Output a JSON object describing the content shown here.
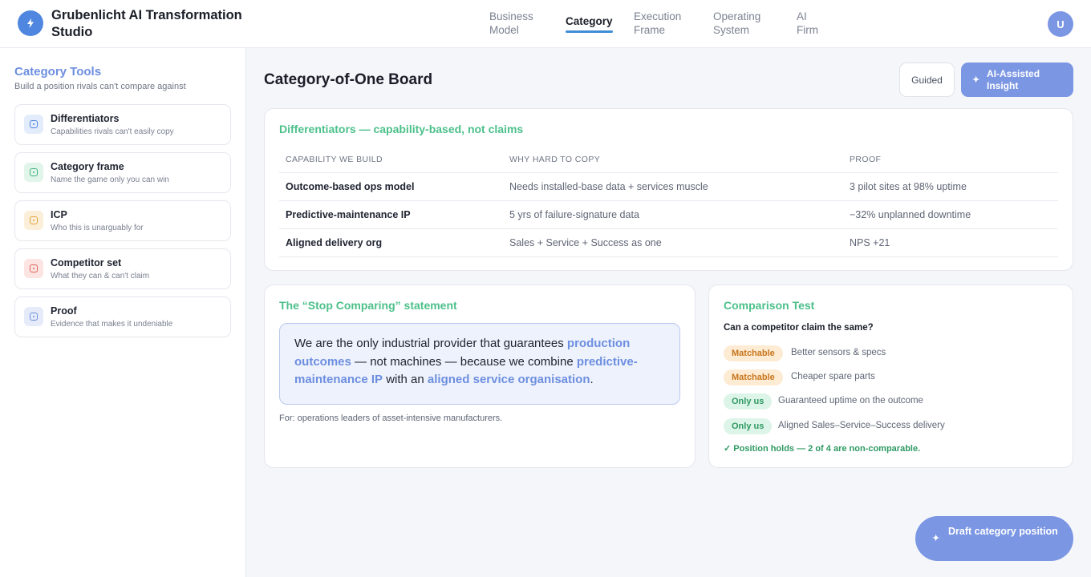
{
  "app": {
    "title": "Grubenlicht AI Transformation Studio",
    "logo_icon": "lightning-bolt-icon",
    "accent_color": "#7b96e3"
  },
  "nav": [
    {
      "label_line1": "Business",
      "label_line2": "Model",
      "active": false
    },
    {
      "label": "Category",
      "active": true
    },
    {
      "label_line1": "Execution",
      "label_line2": "Frame",
      "active": false
    },
    {
      "label_line1": "Operating",
      "label_line2": "System",
      "active": false
    },
    {
      "label_line1": "AI",
      "label_line2": "Firm",
      "active": false
    }
  ],
  "user": {
    "avatar_initial": "U"
  },
  "sidebar": {
    "title": "Category Tools",
    "subtitle": "Build a position rivals can't compare against",
    "tools": [
      {
        "name": "Differentiators",
        "desc": "Capabilities rivals can't easily copy",
        "icon": "differentiators-icon",
        "color": "#4f86df"
      },
      {
        "name": "Category frame",
        "desc": "Name the game only you can win",
        "icon": "category-frame-icon",
        "color": "#3fb27a"
      },
      {
        "name": "ICP",
        "desc": "Who this is unarguably for",
        "icon": "icp-icon",
        "color": "#e3a13a"
      },
      {
        "name": "Competitor set",
        "desc": "What they can & can't claim",
        "icon": "competitor-set-icon",
        "color": "#e0625a"
      },
      {
        "name": "Proof",
        "desc": "Evidence that makes it undeniable",
        "icon": "proof-icon",
        "color": "#6d8fe0"
      }
    ]
  },
  "main": {
    "title": "Category-of-One Board",
    "guided_label": "Guided",
    "ai_label": "AI-Assisted Insight"
  },
  "differentiators": {
    "title": "Differentiators — capability-based, not claims",
    "headers": [
      "CAPABILITY WE BUILD",
      "WHY HARD TO COPY",
      "PROOF"
    ],
    "rows": [
      [
        "Outcome-based ops model",
        "Needs installed-base data + services muscle",
        "3 pilot sites at 98% uptime"
      ],
      [
        "Predictive-maintenance IP",
        "5 yrs of failure-signature data",
        "−32% unplanned downtime"
      ],
      [
        "Aligned delivery org",
        "Sales + Service + Success as one",
        "NPS +21"
      ]
    ]
  },
  "statement": {
    "title": "The “Stop Comparing” statement",
    "t1": "We are the only industrial provider that guarantees ",
    "h1": "production outcomes",
    "t2": " — not machines — because we combine ",
    "h2": "predictive-maintenance IP",
    "t3": " with an ",
    "h3": "aligned service organisation",
    "t4": ".",
    "for_line": "For: operations leaders of asset-intensive manufacturers."
  },
  "comparison": {
    "title": "Comparison Test",
    "question": "Can a competitor claim the same?",
    "items": [
      {
        "badge": "Matchable",
        "text": "Better sensors & specs"
      },
      {
        "badge": "Matchable",
        "text": "Cheaper spare parts"
      },
      {
        "badge": "Only us",
        "text": "Guaranteed uptime on the outcome"
      },
      {
        "badge": "Only us",
        "text": "Aligned Sales–Service–Success delivery"
      }
    ],
    "verdict": "✓ Position holds — 2 of 4 are non-comparable."
  },
  "fab": {
    "label": "Draft category position"
  }
}
